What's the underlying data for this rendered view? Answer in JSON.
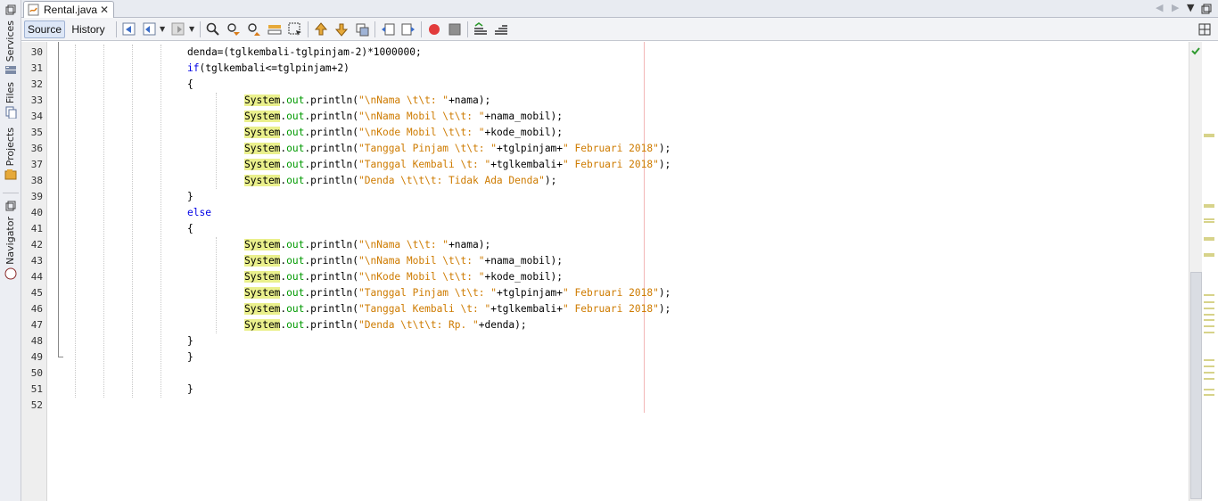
{
  "sidebar": {
    "tabs": [
      {
        "label": "Services",
        "icon": "services-icon"
      },
      {
        "label": "Files",
        "icon": "files-icon"
      },
      {
        "label": "Projects",
        "icon": "projects-icon"
      },
      {
        "label": "Navigator",
        "icon": "navigator-icon"
      }
    ]
  },
  "tab": {
    "filename": "Rental.java",
    "close": "✕"
  },
  "toolbar": {
    "source_label": "Source",
    "history_label": "History"
  },
  "colors": {
    "keyword": "#0000e6",
    "class_highlight": "#eaf08c",
    "field": "#009900",
    "string": "#ce7b00",
    "margin_line": "#f2b6b6"
  },
  "editor": {
    "first_line_number": 30,
    "line_numbers": [
      "30",
      "31",
      "32",
      "33",
      "34",
      "35",
      "36",
      "37",
      "38",
      "39",
      "40",
      "41",
      "42",
      "43",
      "44",
      "45",
      "46",
      "47",
      "48",
      "49",
      "50",
      "51",
      "52"
    ],
    "lines": [
      {
        "indent": 2,
        "tokens": [
          [
            "plain",
            "denda=(tglkembali-tglpinjam-2)*1000000;"
          ]
        ]
      },
      {
        "indent": 2,
        "tokens": [
          [
            "kw",
            "if"
          ],
          [
            "plain",
            "(tglkembali<=tglpinjam+2)"
          ]
        ]
      },
      {
        "indent": 2,
        "tokens": [
          [
            "plain",
            "{"
          ]
        ]
      },
      {
        "indent": 3,
        "tokens": [
          [
            "cls",
            "System"
          ],
          [
            "plain",
            "."
          ],
          [
            "fld",
            "out"
          ],
          [
            "plain",
            ".println("
          ],
          [
            "str",
            "\"\\nNama \\t\\t: \""
          ],
          [
            "plain",
            "+nama);"
          ]
        ]
      },
      {
        "indent": 3,
        "tokens": [
          [
            "cls",
            "System"
          ],
          [
            "plain",
            "."
          ],
          [
            "fld",
            "out"
          ],
          [
            "plain",
            ".println("
          ],
          [
            "str",
            "\"\\nNama Mobil \\t\\t: \""
          ],
          [
            "plain",
            "+nama_mobil);"
          ]
        ]
      },
      {
        "indent": 3,
        "tokens": [
          [
            "cls",
            "System"
          ],
          [
            "plain",
            "."
          ],
          [
            "fld",
            "out"
          ],
          [
            "plain",
            ".println("
          ],
          [
            "str",
            "\"\\nKode Mobil \\t\\t: \""
          ],
          [
            "plain",
            "+kode_mobil);"
          ]
        ]
      },
      {
        "indent": 3,
        "tokens": [
          [
            "cls",
            "System"
          ],
          [
            "plain",
            "."
          ],
          [
            "fld",
            "out"
          ],
          [
            "plain",
            ".println("
          ],
          [
            "str",
            "\"Tanggal Pinjam \\t\\t: \""
          ],
          [
            "plain",
            "+tglpinjam+"
          ],
          [
            "str",
            "\" Februari 2018\""
          ],
          [
            "plain",
            ");"
          ]
        ]
      },
      {
        "indent": 3,
        "tokens": [
          [
            "cls",
            "System"
          ],
          [
            "plain",
            "."
          ],
          [
            "fld",
            "out"
          ],
          [
            "plain",
            ".println("
          ],
          [
            "str",
            "\"Tanggal Kembali \\t: \""
          ],
          [
            "plain",
            "+tglkembali+"
          ],
          [
            "str",
            "\" Februari 2018\""
          ],
          [
            "plain",
            ");"
          ]
        ]
      },
      {
        "indent": 3,
        "tokens": [
          [
            "cls",
            "System"
          ],
          [
            "plain",
            "."
          ],
          [
            "fld",
            "out"
          ],
          [
            "plain",
            ".println("
          ],
          [
            "str",
            "\"Denda \\t\\t\\t: Tidak Ada Denda\""
          ],
          [
            "plain",
            ");"
          ]
        ]
      },
      {
        "indent": 2,
        "tokens": [
          [
            "plain",
            "}"
          ]
        ]
      },
      {
        "indent": 2,
        "tokens": [
          [
            "kw",
            "else"
          ]
        ]
      },
      {
        "indent": 2,
        "tokens": [
          [
            "plain",
            "{"
          ]
        ]
      },
      {
        "indent": 3,
        "tokens": [
          [
            "cls",
            "System"
          ],
          [
            "plain",
            "."
          ],
          [
            "fld",
            "out"
          ],
          [
            "plain",
            ".println("
          ],
          [
            "str",
            "\"\\nNama \\t\\t: \""
          ],
          [
            "plain",
            "+nama);"
          ]
        ]
      },
      {
        "indent": 3,
        "tokens": [
          [
            "cls",
            "System"
          ],
          [
            "plain",
            "."
          ],
          [
            "fld",
            "out"
          ],
          [
            "plain",
            ".println("
          ],
          [
            "str",
            "\"\\nNama Mobil \\t\\t: \""
          ],
          [
            "plain",
            "+nama_mobil);"
          ]
        ]
      },
      {
        "indent": 3,
        "tokens": [
          [
            "cls",
            "System"
          ],
          [
            "plain",
            "."
          ],
          [
            "fld",
            "out"
          ],
          [
            "plain",
            ".println("
          ],
          [
            "str",
            "\"\\nKode Mobil \\t\\t: \""
          ],
          [
            "plain",
            "+kode_mobil);"
          ]
        ]
      },
      {
        "indent": 3,
        "tokens": [
          [
            "cls",
            "System"
          ],
          [
            "plain",
            "."
          ],
          [
            "fld",
            "out"
          ],
          [
            "plain",
            ".println("
          ],
          [
            "str",
            "\"Tanggal Pinjam \\t\\t: \""
          ],
          [
            "plain",
            "+tglpinjam+"
          ],
          [
            "str",
            "\" Februari 2018\""
          ],
          [
            "plain",
            ");"
          ]
        ]
      },
      {
        "indent": 3,
        "tokens": [
          [
            "cls",
            "System"
          ],
          [
            "plain",
            "."
          ],
          [
            "fld",
            "out"
          ],
          [
            "plain",
            ".println("
          ],
          [
            "str",
            "\"Tanggal Kembali \\t: \""
          ],
          [
            "plain",
            "+tglkembali+"
          ],
          [
            "str",
            "\" Februari 2018\""
          ],
          [
            "plain",
            ");"
          ]
        ]
      },
      {
        "indent": 3,
        "tokens": [
          [
            "cls",
            "System"
          ],
          [
            "plain",
            "."
          ],
          [
            "fld",
            "out"
          ],
          [
            "plain",
            ".println("
          ],
          [
            "str",
            "\"Denda \\t\\t\\t: Rp. \""
          ],
          [
            "plain",
            "+denda);"
          ]
        ]
      },
      {
        "indent": 2,
        "tokens": [
          [
            "plain",
            "}"
          ]
        ]
      },
      {
        "indent": 2,
        "tokens": [
          [
            "plain",
            "}"
          ]
        ]
      },
      {
        "indent": 2,
        "tokens": []
      },
      {
        "indent": 2,
        "tokens": [
          [
            "plain",
            "}"
          ]
        ]
      },
      {
        "indent": 2,
        "tokens": []
      }
    ]
  }
}
